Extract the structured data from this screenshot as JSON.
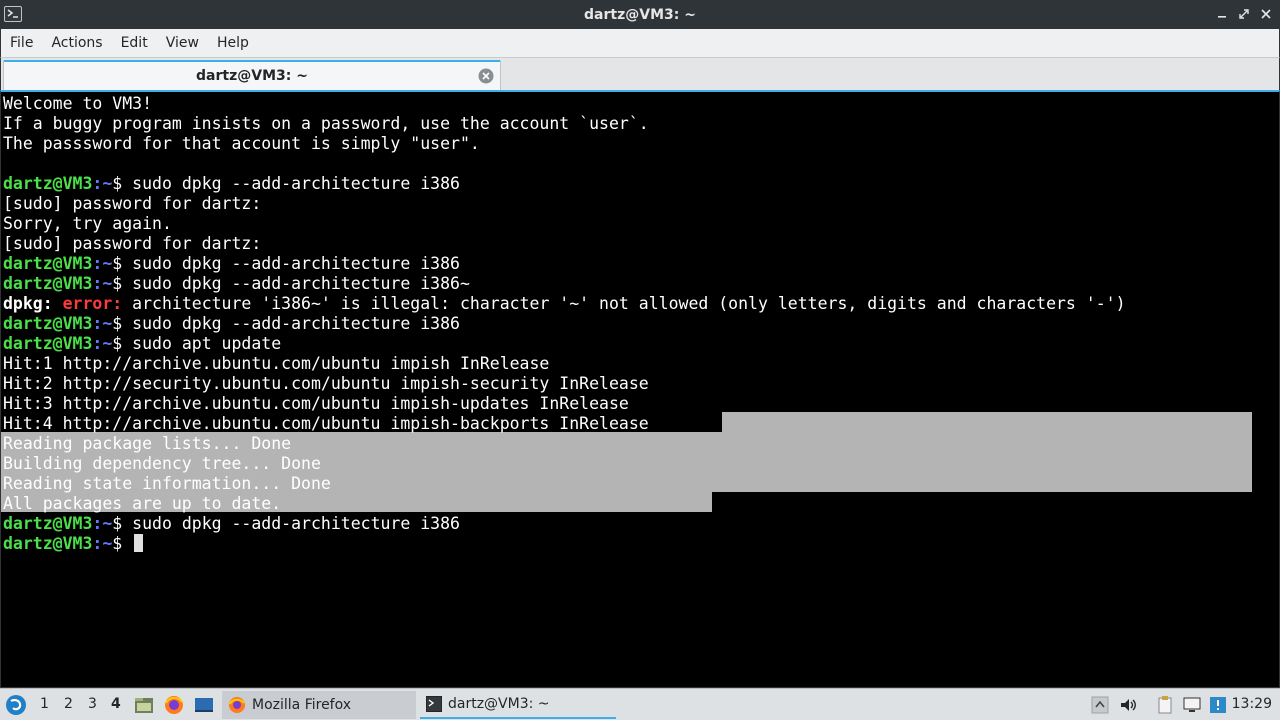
{
  "window": {
    "title": "dartz@VM3: ~"
  },
  "menu": {
    "items": [
      "File",
      "Actions",
      "Edit",
      "View",
      "Help"
    ]
  },
  "tab": {
    "label": "dartz@VM3: ~"
  },
  "terminal": {
    "prompt_user": "dartz@VM3",
    "prompt_path": ":~",
    "prompt_sign": "$ ",
    "lines": [
      {
        "type": "text",
        "text": "Welcome to VM3!"
      },
      {
        "type": "text",
        "text": "If a buggy program insists on a password, use the account `user`."
      },
      {
        "type": "text",
        "text": "The passsword for that account is simply \"user\"."
      },
      {
        "type": "text",
        "text": ""
      },
      {
        "type": "prompt",
        "text": "sudo dpkg --add-architecture i386"
      },
      {
        "type": "text",
        "text": "[sudo] password for dartz:"
      },
      {
        "type": "text",
        "text": "Sorry, try again."
      },
      {
        "type": "text",
        "text": "[sudo] password for dartz:"
      },
      {
        "type": "prompt",
        "text": "sudo dpkg --add-architecture i386"
      },
      {
        "type": "prompt",
        "text": "sudo dpkg --add-architecture i386~"
      },
      {
        "type": "error",
        "label": "dpkg:",
        "word": "error:",
        "text": " architecture 'i386~' is illegal: character '~' not allowed (only letters, digits and characters '-')"
      },
      {
        "type": "prompt",
        "text": "sudo dpkg --add-architecture i386"
      },
      {
        "type": "prompt",
        "text": "sudo apt update"
      },
      {
        "type": "text",
        "text": "Hit:1 http://archive.ubuntu.com/ubuntu impish InRelease"
      },
      {
        "type": "text",
        "text": "Hit:2 http://security.ubuntu.com/ubuntu impish-security InRelease"
      },
      {
        "type": "text",
        "text": "Hit:3 http://archive.ubuntu.com/ubuntu impish-updates InRelease"
      },
      {
        "type": "text",
        "text": "Hit:4 http://archive.ubuntu.com/ubuntu impish-backports InRelease"
      },
      {
        "type": "text",
        "text": "Reading package lists... Done"
      },
      {
        "type": "text",
        "text": "Building dependency tree... Done"
      },
      {
        "type": "text",
        "text": "Reading state information... Done"
      },
      {
        "type": "text",
        "text": "All packages are up to date."
      },
      {
        "type": "prompt",
        "text": "sudo dpkg --add-architecture i386"
      },
      {
        "type": "prompt",
        "text": "",
        "cursor": true
      }
    ]
  },
  "taskbar": {
    "desktops": [
      "1",
      "2",
      "3",
      "4"
    ],
    "active_desktop": "4",
    "tasks": [
      {
        "label": "Mozilla Firefox",
        "icon": "firefox-icon"
      },
      {
        "label": "dartz@VM3: ~",
        "icon": "terminal-icon"
      }
    ],
    "clock": "13:29"
  },
  "colors": {
    "accent": "#3daee9",
    "prompt_user": "#4be04b",
    "prompt_path": "#5e7bff",
    "error": "#ff3a3a",
    "selection": "#b4b4b4"
  }
}
